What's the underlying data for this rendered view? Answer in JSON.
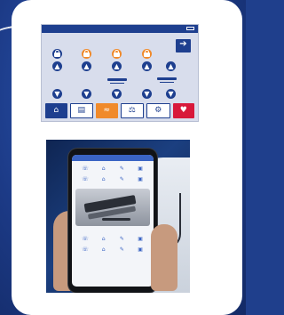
{
  "panel": {
    "exit_icon": "arrow-right-icon",
    "exit_arrow": "➔",
    "row_up": [
      "▲",
      "▲",
      "▲",
      "▲",
      "▲"
    ],
    "row_down": [
      "▼",
      "▼",
      "▼",
      "▼",
      "▼"
    ],
    "nav": {
      "home": "⌂",
      "doc": "▤",
      "bed": "≈",
      "scale": "⚖",
      "settings": "⚙",
      "heart": "♥"
    },
    "colors": {
      "primary": "#1e3f8f",
      "lock_orange": "#f08a2b",
      "alert_red": "#d8183a"
    }
  },
  "phone": {
    "icons_top": [
      "☏",
      "⌂",
      "✎",
      "▣",
      "☏",
      "⌂",
      "✎",
      "▣"
    ],
    "icons_bottom": [
      "☏",
      "⌂",
      "✎",
      "▣",
      "☏",
      "⌂",
      "✎",
      "▣"
    ]
  }
}
